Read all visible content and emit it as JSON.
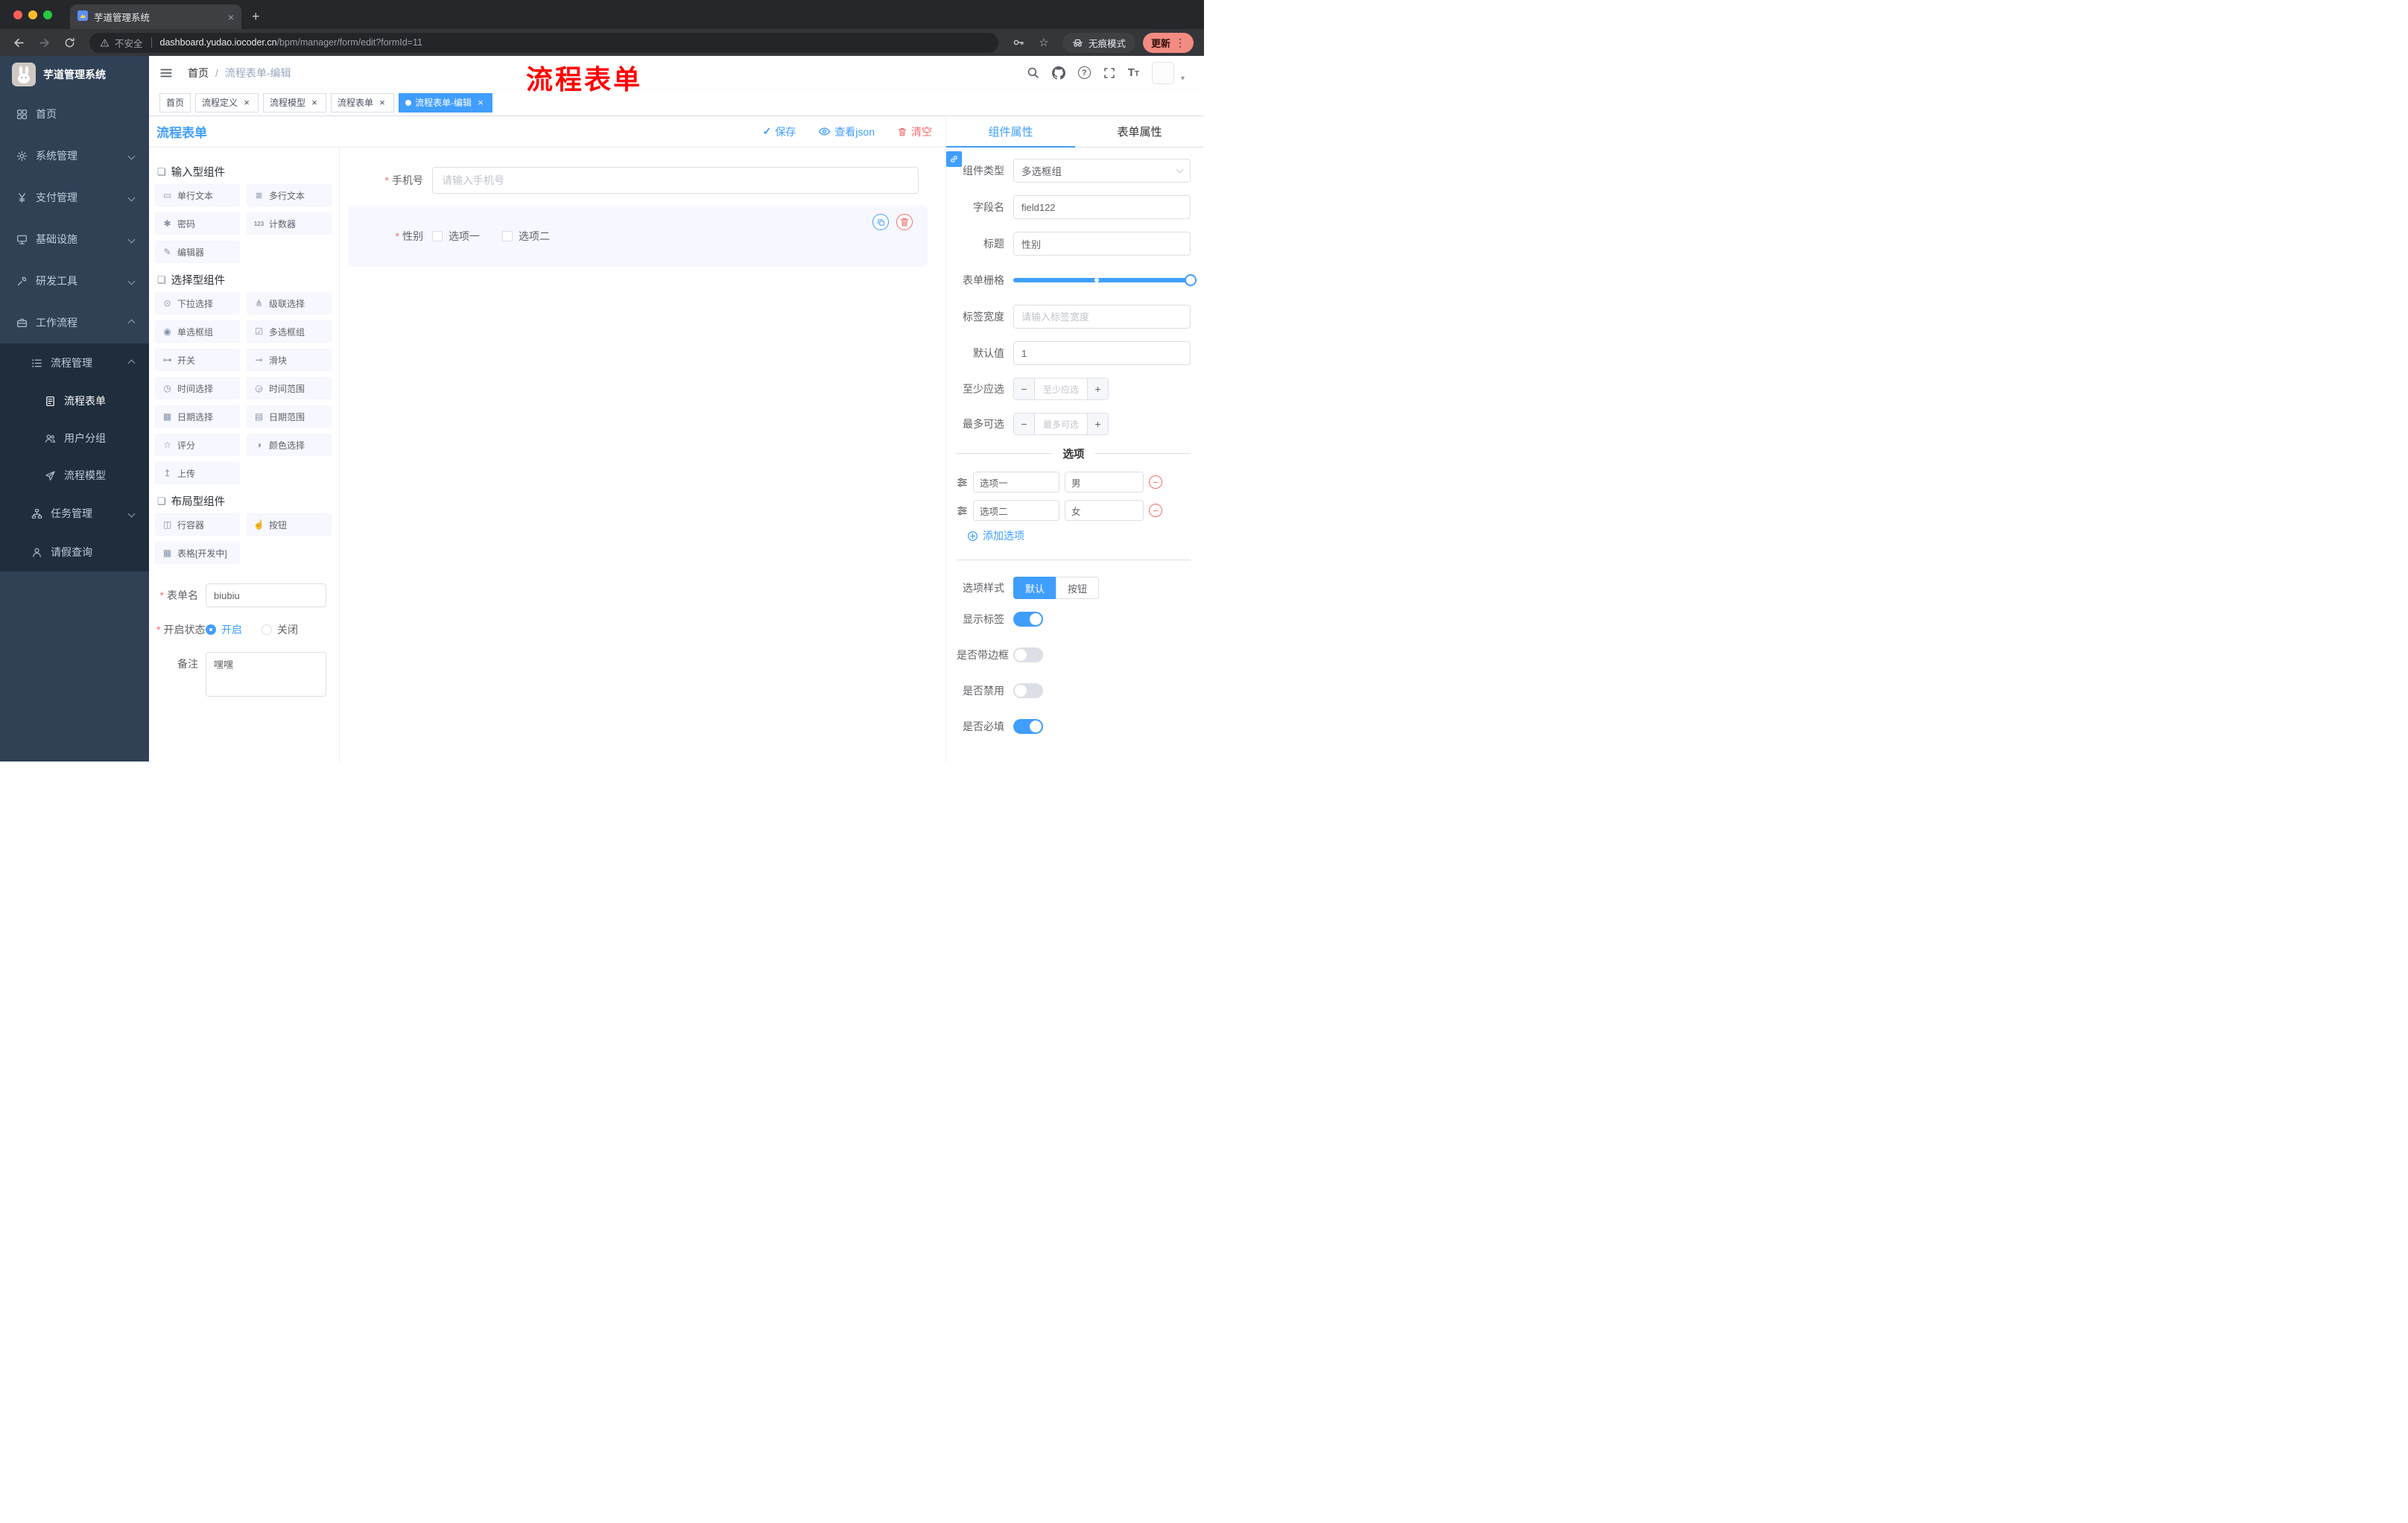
{
  "theme": {
    "primary": "#409eff",
    "danger": "#f56c6c",
    "sidebar_bg": "#304156",
    "submenu_bg": "#1f2d3d",
    "annotation_color": "#ff0000"
  },
  "browser": {
    "tab": {
      "title": "芋道管理系统"
    },
    "address": {
      "security_label": "不安全",
      "url_host": "dashboard.yudao.iocoder.cn",
      "url_path": "/bpm/manager/form/edit?formId=11"
    },
    "incognito_label": "无痕模式",
    "update_label": "更新"
  },
  "annotation": {
    "text": "流程表单"
  },
  "sidebar": {
    "logo_title": "芋道管理系统",
    "menu": [
      {
        "key": "home",
        "label": "首页",
        "icon": "dashboard-icon",
        "level": 0
      },
      {
        "key": "system-mgmt",
        "label": "系统管理",
        "icon": "gear-icon",
        "level": 0,
        "chevron": "down"
      },
      {
        "key": "payment-mgmt",
        "label": "支付管理",
        "icon": "yen-icon",
        "level": 0,
        "chevron": "down"
      },
      {
        "key": "infrastructure",
        "label": "基础设施",
        "icon": "monitor-icon",
        "level": 0,
        "chevron": "down"
      },
      {
        "key": "devtools",
        "label": "研发工具",
        "icon": "tools-icon",
        "level": 0,
        "chevron": "down"
      },
      {
        "key": "workflow",
        "label": "工作流程",
        "icon": "briefcase-icon",
        "level": 0,
        "chevron": "up"
      },
      {
        "key": "process-mgmt",
        "label": "流程管理",
        "icon": "list-icon",
        "level": 1,
        "chevron": "up"
      },
      {
        "key": "process-form",
        "label": "流程表单",
        "icon": "doc-icon",
        "level": 2,
        "active": true
      },
      {
        "key": "user-group",
        "label": "用户分组",
        "icon": "users-icon",
        "level": 2
      },
      {
        "key": "process-model",
        "label": "流程模型",
        "icon": "send-icon",
        "level": 2
      },
      {
        "key": "task-mgmt",
        "label": "任务管理",
        "icon": "tree-icon",
        "level": 1,
        "chevron": "down"
      },
      {
        "key": "leave-query",
        "label": "请假查询",
        "icon": "user-icon",
        "level": 1
      }
    ]
  },
  "header": {
    "breadcrumb": [
      "首页",
      "流程表单-编辑"
    ]
  },
  "tags": [
    {
      "key": "home",
      "label": "首页"
    },
    {
      "key": "process-definition",
      "label": "流程定义",
      "closable": true
    },
    {
      "key": "process-model",
      "label": "流程模型",
      "closable": true
    },
    {
      "key": "process-form",
      "label": "流程表单",
      "closable": true
    },
    {
      "key": "process-form-edit",
      "label": "流程表单-编辑",
      "closable": true,
      "active": true
    }
  ],
  "designer": {
    "title": "流程表单",
    "toolbar": {
      "save": "保存",
      "view_json": "查看json",
      "clear": "清空"
    },
    "palette": {
      "groups": [
        {
          "title": "输入型组件",
          "items": [
            {
              "key": "single-line-text",
              "label": "单行文本",
              "icon": "single-line-text-icon"
            },
            {
              "key": "textarea",
              "label": "多行文本",
              "icon": "textarea-icon"
            },
            {
              "key": "password",
              "label": "密码",
              "icon": "password-icon"
            },
            {
              "key": "counter",
              "label": "计数器",
              "icon": "counter-icon"
            },
            {
              "key": "editor",
              "label": "编辑器",
              "icon": "editor-icon"
            }
          ]
        },
        {
          "title": "选择型组件",
          "items": [
            {
              "key": "select",
              "label": "下拉选择",
              "icon": "select-icon"
            },
            {
              "key": "cascader",
              "label": "级联选择",
              "icon": "cascader-icon"
            },
            {
              "key": "radio-group",
              "label": "单选框组",
              "icon": "radio-group-icon"
            },
            {
              "key": "checkbox-group",
              "label": "多选框组",
              "icon": "checkbox-group-icon"
            },
            {
              "key": "switch",
              "label": "开关",
              "icon": "switch-icon"
            },
            {
              "key": "slider",
              "label": "滑块",
              "icon": "slider-icon"
            },
            {
              "key": "time-picker",
              "label": "时间选择",
              "icon": "time-icon"
            },
            {
              "key": "time-range",
              "label": "时间范围",
              "icon": "time-range-icon"
            },
            {
              "key": "date-picker",
              "label": "日期选择",
              "icon": "date-icon"
            },
            {
              "key": "date-range",
              "label": "日期范围",
              "icon": "date-range-icon"
            },
            {
              "key": "rate",
              "label": "评分",
              "icon": "rate-icon"
            },
            {
              "key": "color-picker",
              "label": "颜色选择",
              "icon": "color-icon"
            },
            {
              "key": "upload",
              "label": "上传",
              "icon": "upload-icon"
            }
          ]
        },
        {
          "title": "布局型组件",
          "items": [
            {
              "key": "row-container",
              "label": "行容器",
              "icon": "row-container-icon"
            },
            {
              "key": "button",
              "label": "按钮",
              "icon": "button-icon"
            },
            {
              "key": "table",
              "label": "表格[开发中]",
              "icon": "table-icon"
            }
          ]
        }
      ]
    },
    "form_meta": {
      "name_label": "表单名",
      "name_value": "biubiu",
      "status_label": "开启状态",
      "status_on": "开启",
      "status_off": "关闭",
      "status_value": "开启",
      "remark_label": "备注",
      "remark_value": "嘿嘿"
    },
    "canvas": {
      "items": [
        {
          "key": "phone",
          "type": "input",
          "required": true,
          "label": "手机号",
          "placeholder": "请输入手机号"
        },
        {
          "key": "gender",
          "type": "checkbox-group",
          "required": true,
          "label": "性别",
          "options": [
            "选项一",
            "选项二"
          ],
          "selected": true
        }
      ]
    },
    "props": {
      "tabs": [
        {
          "label": "组件属性",
          "active": true
        },
        {
          "label": "表单属性"
        }
      ],
      "rows": [
        {
          "key": "component-type",
          "label": "组件类型",
          "control": "select",
          "value": "多选框组"
        },
        {
          "key": "field-name",
          "label": "字段名",
          "control": "input",
          "value": "field122"
        },
        {
          "key": "title",
          "label": "标题",
          "control": "input",
          "value": "性别"
        },
        {
          "key": "form-grid",
          "label": "表单栅格",
          "control": "slider",
          "value": 24,
          "max": 24
        },
        {
          "key": "label-width",
          "label": "标签宽度",
          "control": "input",
          "placeholder": "请输入标签宽度"
        },
        {
          "key": "default-value",
          "label": "默认值",
          "control": "input",
          "value": "1"
        },
        {
          "key": "min-select",
          "label": "至少应选",
          "control": "stepper",
          "placeholder": "至少应选"
        },
        {
          "key": "max-select",
          "label": "最多可选",
          "control": "stepper",
          "placeholder": "最多可选"
        }
      ],
      "options_divider": "选项",
      "options": [
        {
          "name": "选项一",
          "value": "男"
        },
        {
          "name": "选项二",
          "value": "女"
        }
      ],
      "add_option_label": "添加选项",
      "style_row": {
        "label": "选项样式",
        "choices": [
          "默认",
          "按钮"
        ],
        "active": "默认"
      },
      "switches": [
        {
          "key": "show-label",
          "label": "显示标签",
          "on": true
        },
        {
          "key": "with-border",
          "label": "是否带边框",
          "on": false
        },
        {
          "key": "disabled",
          "label": "是否禁用",
          "on": false
        },
        {
          "key": "required",
          "label": "是否必填",
          "on": true
        }
      ]
    }
  },
  "icon_glyphs": {
    "single-line-text-icon": "▭",
    "textarea-icon": "≣",
    "password-icon": "✱",
    "counter-icon": "123",
    "editor-icon": "✎",
    "select-icon": "⊙",
    "cascader-icon": "⋔",
    "radio-group-icon": "◉",
    "checkbox-group-icon": "☑",
    "switch-icon": "⊶",
    "slider-icon": "⊸",
    "time-icon": "◷",
    "time-range-icon": "◶",
    "date-icon": "▦",
    "date-range-icon": "▤",
    "rate-icon": "☆",
    "color-icon": "◑",
    "upload-icon": "↥",
    "row-container-icon": "◫",
    "button-icon": "☝",
    "table-icon": "▦",
    "component-group-icon": "❏"
  }
}
